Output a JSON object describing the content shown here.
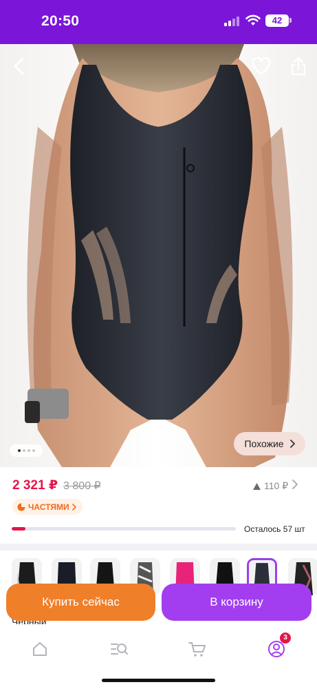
{
  "status_bar": {
    "time": "20:50",
    "battery": "42",
    "icons": [
      "signal-icon",
      "wifi-icon",
      "battery-icon"
    ]
  },
  "product_image": {
    "nav_icons": [
      "back-arrow-icon",
      "heart-icon",
      "share-icon"
    ],
    "gallery_dots": 4,
    "active_dot": 1,
    "similar_label": "Похожие"
  },
  "price": {
    "current": "2 321 ₽",
    "old": "3 800 ₽",
    "delta": "110 ₽"
  },
  "installments": {
    "label": "ЧАСТЯМИ"
  },
  "stock": {
    "label": "Осталось 57 шт",
    "progress_fraction": 0.06
  },
  "color_options": {
    "count": 8,
    "selected_index": 6,
    "selected_label": "Черный"
  },
  "actions": {
    "buy_now": "Купить сейчас",
    "add_to_cart": "В корзину"
  },
  "tab_bar": {
    "icons": [
      "home-icon",
      "catalog-search-icon",
      "cart-icon",
      "profile-icon"
    ],
    "profile_badge": "3"
  },
  "colors": {
    "brand_purple": "#7b16d9",
    "price_red": "#e4154b",
    "buy_orange": "#f07f2a",
    "cart_purple": "#a23ef0"
  }
}
